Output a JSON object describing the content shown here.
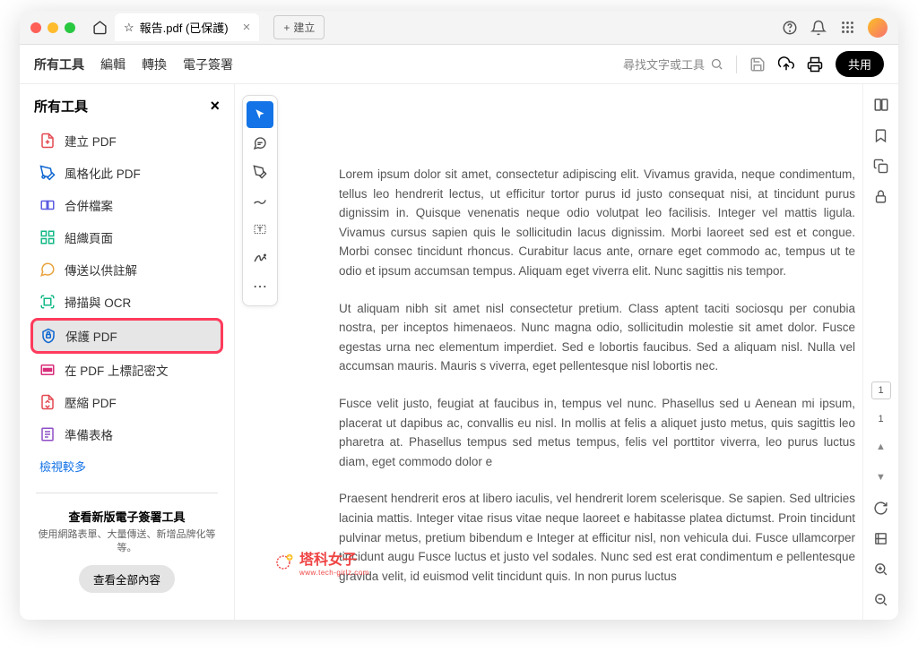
{
  "titlebar": {
    "tab_title": "報告.pdf (已保護)",
    "new_tab": "建立"
  },
  "toolbar": {
    "tabs": [
      "所有工具",
      "編輯",
      "轉換",
      "電子簽署"
    ],
    "search_placeholder": "尋找文字或工具",
    "share": "共用"
  },
  "sidebar": {
    "title": "所有工具",
    "items": [
      {
        "label": "建立 PDF",
        "icon": "create-pdf"
      },
      {
        "label": "風格化此 PDF",
        "icon": "style-pdf"
      },
      {
        "label": "合併檔案",
        "icon": "combine"
      },
      {
        "label": "組織頁面",
        "icon": "organize"
      },
      {
        "label": "傳送以供註解",
        "icon": "send-comment"
      },
      {
        "label": "掃描與 OCR",
        "icon": "scan-ocr"
      },
      {
        "label": "保護 PDF",
        "icon": "protect-pdf",
        "highlight": true
      },
      {
        "label": "在 PDF 上標記密文",
        "icon": "redact"
      },
      {
        "label": "壓縮 PDF",
        "icon": "compress"
      },
      {
        "label": "準備表格",
        "icon": "prepare-form"
      }
    ],
    "more": "檢視較多",
    "promo": {
      "title": "查看新版電子簽署工具",
      "sub": "使用網路表單、大量傳送、新增品牌化等等。",
      "btn": "查看全部內容"
    }
  },
  "doc": {
    "p1": "Lorem ipsum dolor sit amet, consectetur adipiscing elit. Vivamus gravida, neque condimentum, tellus leo hendrerit lectus, ut efficitur tortor purus id justo consequat nisi, at tincidunt purus dignissim in. Quisque venenatis neque odio volutpat leo facilisis. Integer vel mattis ligula. Vivamus cursus sapien quis le sollicitudin lacus dignissim. Morbi laoreet sed est et congue. Morbi consec tincidunt rhoncus. Curabitur lacus ante, ornare eget commodo ac, tempus ut te odio et ipsum accumsan tempus. Aliquam eget viverra elit. Nunc sagittis nis tempor.",
    "p2": "Ut aliquam nibh sit amet nisl consectetur pretium. Class aptent taciti sociosqu per conubia nostra, per inceptos himenaeos. Nunc magna odio, sollicitudin molestie sit amet dolor. Fusce egestas urna nec elementum imperdiet. Sed e lobortis faucibus. Sed a aliquam nisl. Nulla vel accumsan mauris. Mauris s viverra, eget pellentesque nisl lobortis nec.",
    "p3": "Fusce velit justo, feugiat at faucibus in, tempus vel nunc. Phasellus sed u Aenean mi ipsum, placerat ut dapibus ac, convallis eu nisl. In mollis at felis a aliquet justo metus, quis sagittis leo pharetra at. Phasellus tempus sed metus tempus, felis vel porttitor viverra, leo purus luctus diam, eget commodo dolor e",
    "p4": "Praesent hendrerit eros at libero iaculis, vel hendrerit lorem scelerisque. Se sapien. Sed ultricies lacinia mattis. Integer vitae risus vitae neque laoreet e habitasse platea dictumst. Proin tincidunt pulvinar metus, pretium bibendum e Integer at efficitur nisl, non vehicula dui. Fusce ullamcorper tincidunt augu Fusce luctus et justo vel sodales. Nunc sed est erat condimentum e pellentesque gravida velit, id euismod velit tincidunt quis. In non purus luctus"
  },
  "pagenav": {
    "current": "1",
    "total": "1"
  },
  "watermark": {
    "main": "塔科女子",
    "sub": "www.tech-girlz.com"
  }
}
